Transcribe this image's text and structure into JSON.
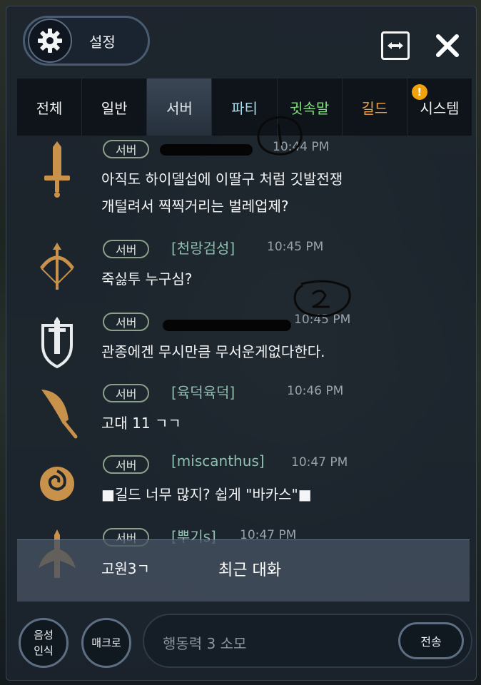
{
  "header": {
    "settings_label": "설정"
  },
  "tabs": [
    {
      "label": "전체"
    },
    {
      "label": "일반"
    },
    {
      "label": "서버"
    },
    {
      "label": "파티"
    },
    {
      "label": "귓속말"
    },
    {
      "label": "길드"
    },
    {
      "label": "시스템",
      "alert": "!"
    }
  ],
  "messages": [
    {
      "channel": "서버",
      "name": "",
      "time": "10:44 PM",
      "lines": [
        "아직도 하이델섭에 이딸구 처럼 깃발전쟁",
        "개털려서 찍찍거리는 벌레업제?"
      ],
      "redacted": true,
      "icon": "sword-icon"
    },
    {
      "channel": "서버",
      "name": "[천랑검성]",
      "time": "10:45 PM",
      "lines": [
        "죽싫투 누구심?"
      ],
      "icon": "crossbow-icon"
    },
    {
      "channel": "서버",
      "name": "",
      "time": "10:45 PM",
      "lines": [
        "관종에겐 무시만큼 무서운게없다한다."
      ],
      "redacted": true,
      "icon": "shield-sword-icon"
    },
    {
      "channel": "서버",
      "name": "[육덕육덕]",
      "time": "10:46 PM",
      "lines": [
        "고대 11 ㄱㄱ"
      ],
      "icon": "blade-icon"
    },
    {
      "channel": "서버",
      "name": "[miscanthus]",
      "time": "10:47 PM",
      "lines": [
        "■길드 너무 많지? 쉽게 \"바카스\"■"
      ],
      "icon": "rose-icon"
    },
    {
      "channel": "서버",
      "name": "[뿌기s]",
      "time": "10:47 PM",
      "lines": [
        "고원3ㄱ"
      ],
      "icon": "winged-sword-icon"
    }
  ],
  "recent_conversation_label": "최근 대화",
  "bottom": {
    "voice_label_1": "음성",
    "voice_label_2": "인식",
    "macro_label": "매크로",
    "input_placeholder": "행동력 3 소모",
    "send_label": "전송"
  },
  "colors": {
    "party": "#a8dff2",
    "whisper": "#7fe07a",
    "guild": "#f0a245",
    "player_name": "#8fc0b0",
    "alert": "#f0a20c"
  }
}
